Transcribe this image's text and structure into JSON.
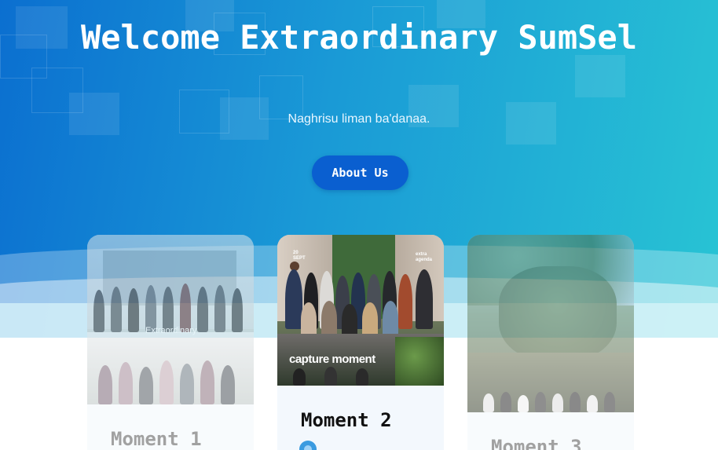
{
  "hero": {
    "title": "Welcome Extraordinary SumSel",
    "subtitle": "Naghrisu liman ba'danaa.",
    "about_label": "About Us"
  },
  "cards": [
    {
      "title": "Moment 1",
      "photo_caption": "Extraordinary"
    },
    {
      "title": "Moment 2",
      "photo_caption": "capture moment",
      "overlay_left": "20\nSEPT",
      "overlay_right": "extra\nagenda"
    },
    {
      "title": "Moment 3"
    }
  ],
  "colors": {
    "hero_start": "#0b6fd0",
    "hero_end": "#28c4d4",
    "button": "#0a5fd0"
  },
  "icons": {
    "badge": "gear-badge-icon"
  }
}
